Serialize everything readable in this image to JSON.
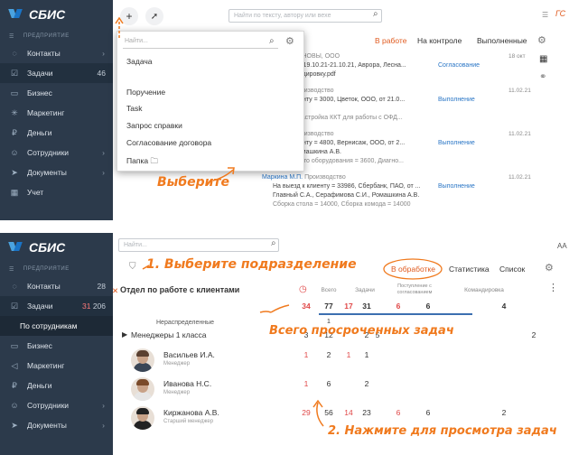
{
  "app": {
    "brand": "СБИС",
    "org_label": "ПРЕДПРИЯТИЕ",
    "avatar_initials": "ГС",
    "accent": "#e05a1e",
    "sidebar_bg": "#2c3a4b",
    "link": "#2a76c6"
  },
  "top": {
    "sidebar": [
      {
        "label": "Контакты",
        "icon": "chat-icon",
        "chevron": true
      },
      {
        "label": "Задачи",
        "icon": "checklist-icon",
        "count": "46",
        "active": true
      },
      {
        "label": "Бизнес",
        "icon": "briefcase-icon"
      },
      {
        "label": "Маркетинг",
        "icon": "star-icon"
      },
      {
        "label": "Деньги",
        "icon": "money-icon"
      },
      {
        "label": "Сотрудники",
        "icon": "people-icon",
        "chevron": true
      },
      {
        "label": "Документы",
        "icon": "send-icon",
        "chevron": true
      },
      {
        "label": "Учет",
        "icon": "calculator-icon"
      }
    ],
    "search_placeholder": "Найти по тексту, автору или вехе",
    "tabs": [
      "В работе",
      "На контроле",
      "Выполненные"
    ],
    "dropdown": {
      "search_placeholder": "Найти...",
      "items": [
        "Задача",
        "Поручение",
        "Task",
        "Запрос справки",
        "Согласование договора",
        "Папка"
      ]
    },
    "annotation": "Выберите",
    "tasks": [
      {
        "author": "И.",
        "dept": "ОСНОВЫ, ООО",
        "line1": "ровка 19.10.21-21.10.21, Аврора, Лесна...",
        "line2": "командировку.pdf",
        "status": "Согласование",
        "date": "18 окт"
      },
      {
        "author": "П.",
        "dept": "Производство",
        "line1": "к клиенту = 3000, Цветок, ООО, от 21.0...",
        "line2": "А.",
        "line3": "ка и настройка ККТ для работы с ОФД...",
        "status": "Выполнение",
        "date": "11.02.21"
      },
      {
        "author": "П.",
        "dept": "Производство",
        "line1": "к клиенту = 4800, Вернисаж, ООО, от 2...",
        "line2": "А., Ромашкина А.В.",
        "line3": "рогового оборудования = 3600, Диагно...",
        "status": "Выполнение",
        "date": "11.02.21"
      },
      {
        "author": "Маркина М.П.",
        "dept": "Производство",
        "line1": "На выезд к клиенту = 33986, Сбербанк, ПАО, от ...",
        "line2": "Главный С.А., Серафимова С.И., Ромашкина А.В.",
        "line3": "Сборка стола = 14000, Сборка комода = 14000",
        "status": "Выполнение",
        "date": "11.02.21"
      }
    ]
  },
  "bottom": {
    "sidebar": [
      {
        "label": "Контакты",
        "icon": "chat-icon",
        "count": "28"
      },
      {
        "label": "Задачи",
        "icon": "checklist-icon",
        "count_red": "31",
        "count": "206",
        "active": true
      },
      {
        "label": "По сотрудникам",
        "sub": true
      },
      {
        "label": "Бизнес",
        "icon": "briefcase-icon"
      },
      {
        "label": "Маркетинг",
        "icon": "megaphone-icon"
      },
      {
        "label": "Деньги",
        "icon": "money-icon"
      },
      {
        "label": "Сотрудники",
        "icon": "people-icon",
        "chevron": true
      },
      {
        "label": "Документы",
        "icon": "send-icon",
        "chevron": true
      }
    ],
    "search_placeholder": "Найти...",
    "annotation1": "1. Выберите подразделение",
    "annotation_total": "Всего просроченных задач",
    "annotation2": "2. Нажмите для просмотра задач",
    "tabs": [
      "В обработке",
      "Статистика",
      "Список"
    ],
    "department": "Отдел по работе с клиентами",
    "columns": [
      "Всего",
      "Задачи",
      "Поступление с согласованием",
      "Командировка"
    ],
    "totals": {
      "overdue": "34",
      "all": "77",
      "tasks_overdue": "17",
      "tasks": "31",
      "approval_overdue": "6",
      "approval": "6",
      "trip": "4"
    },
    "unassigned": {
      "label": "Нераспределенные",
      "value": "1"
    },
    "group": {
      "label": "Менеджеры 1 класса",
      "overdue": "3",
      "all": "12",
      "tasks": "2",
      "approval": "5",
      "trip": "2"
    },
    "employees": [
      {
        "name": "Васильев И.А.",
        "role": "Менеджер",
        "overdue": "1",
        "all": "2",
        "tasks_overdue": "1",
        "tasks": "1"
      },
      {
        "name": "Иванова Н.С.",
        "role": "Менеджер",
        "overdue": "1",
        "all": "6",
        "tasks": "2"
      },
      {
        "name": "Киржанова А.В.",
        "role": "Старший менеджер",
        "overdue": "29",
        "all": "56",
        "tasks_overdue": "14",
        "tasks": "23",
        "approval_overdue": "6",
        "approval": "6",
        "trip": "2"
      }
    ]
  }
}
